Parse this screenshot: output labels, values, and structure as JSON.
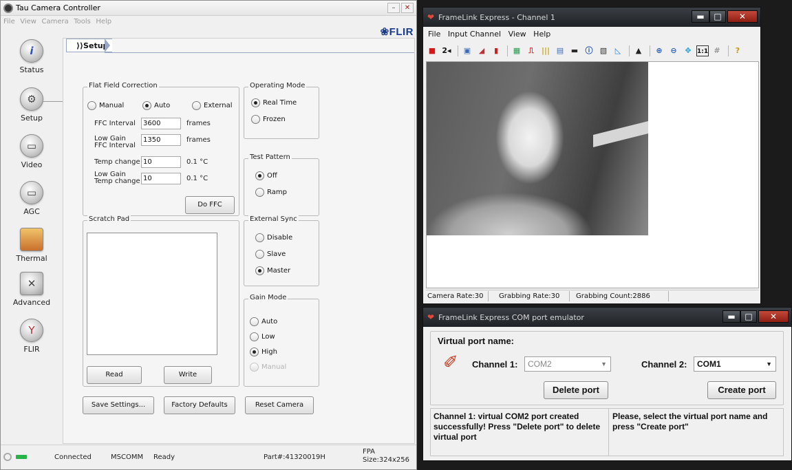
{
  "tau": {
    "title": "Tau Camera Controller",
    "menu": [
      "File",
      "View",
      "Camera",
      "Tools",
      "Help"
    ],
    "logo": "❀FLIR",
    "breadcrumb": "⟩⟩Setup",
    "sidebar": [
      {
        "label": "Status",
        "icon": "info-icon"
      },
      {
        "label": "Setup",
        "icon": "setup-icon"
      },
      {
        "label": "Video",
        "icon": "video-icon"
      },
      {
        "label": "AGC",
        "icon": "agc-icon"
      },
      {
        "label": "Thermal",
        "icon": "thermal-icon"
      },
      {
        "label": "Advanced",
        "icon": "advanced-icon"
      },
      {
        "label": "FLIR",
        "icon": "flir-icon"
      }
    ],
    "ffc": {
      "legend": "Flat Field Correction",
      "mode_manual": "Manual",
      "mode_auto": "Auto",
      "mode_external": "External",
      "interval_label": "FFC Interval",
      "interval_value": "3600",
      "interval_unit": "frames",
      "lowgain_label_1": "Low Gain",
      "lowgain_label_2": "FFC Interval",
      "lowgain_value": "1350",
      "lowgain_unit": "frames",
      "temp_label": "Temp change",
      "temp_value": "10",
      "temp_unit": "0.1 °C",
      "lowtemp_label_1": "Low Gain",
      "lowtemp_label_2": "Temp change",
      "lowtemp_value": "10",
      "lowtemp_unit": "0.1 °C",
      "do_ffc": "Do FFC"
    },
    "operating_mode": {
      "legend": "Operating Mode",
      "real_time": "Real Time",
      "frozen": "Frozen"
    },
    "test_pattern": {
      "legend": "Test Pattern",
      "off": "Off",
      "ramp": "Ramp"
    },
    "external_sync": {
      "legend": "External Sync",
      "disable": "Disable",
      "slave": "Slave",
      "master": "Master"
    },
    "gain_mode": {
      "legend": "Gain Mode",
      "auto": "Auto",
      "low": "Low",
      "high": "High",
      "manual": "Manual"
    },
    "scratch": {
      "legend": "Scratch Pad",
      "read": "Read",
      "write": "Write"
    },
    "buttons": {
      "save": "Save Settings...",
      "factory": "Factory Defaults",
      "reset": "Reset Camera"
    },
    "status": {
      "connected": "Connected",
      "mscomm": "MSCOMM",
      "ready": "Ready",
      "part": "Part#:41320019H",
      "fpa_1": "FPA",
      "fpa_2": "Size:324x256"
    }
  },
  "framelink": {
    "title": "FrameLink Express - Channel 1",
    "menu": [
      "File",
      "Input Channel",
      "View",
      "Help"
    ],
    "status": {
      "camera_rate": "Camera Rate:30",
      "grabbing_rate": "Grabbing Rate:30",
      "grabbing_count": "Grabbing Count:2886"
    }
  },
  "com": {
    "title": "FrameLink Express COM port emulator",
    "virtual_port_label": "Virtual port name:",
    "ch1_label": "Channel 1:",
    "ch1_value": "COM2",
    "ch2_label": "Channel 2:",
    "ch2_value": "COM1",
    "delete_port": "Delete port",
    "create_port": "Create port",
    "msg_left": "Channel 1: virtual COM2 port created successfully! Press \"Delete port\" to delete virtual port",
    "msg_right": "Please, select the virtual port name and press \"Create port\""
  },
  "colors": {
    "flir_blue": "#1a3b8a",
    "connected_led": "#27b34a",
    "titlebar_dark": "#1f2226"
  }
}
